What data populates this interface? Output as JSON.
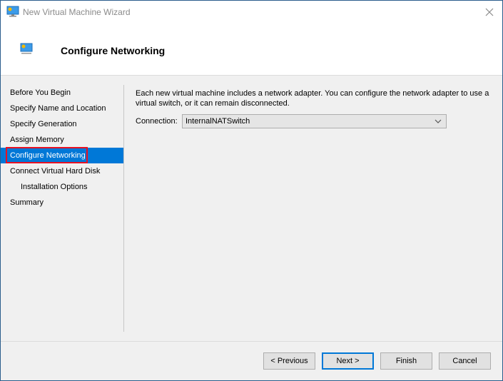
{
  "window": {
    "title": "New Virtual Machine Wizard",
    "close_label": "Close"
  },
  "header": {
    "title": "Configure Networking"
  },
  "sidebar": {
    "items": [
      {
        "label": "Before You Begin",
        "active": false,
        "sub": false
      },
      {
        "label": "Specify Name and Location",
        "active": false,
        "sub": false
      },
      {
        "label": "Specify Generation",
        "active": false,
        "sub": false
      },
      {
        "label": "Assign Memory",
        "active": false,
        "sub": false
      },
      {
        "label": "Configure Networking",
        "active": true,
        "sub": false
      },
      {
        "label": "Connect Virtual Hard Disk",
        "active": false,
        "sub": false
      },
      {
        "label": "Installation Options",
        "active": false,
        "sub": true
      },
      {
        "label": "Summary",
        "active": false,
        "sub": false
      }
    ]
  },
  "main": {
    "description": "Each new virtual machine includes a network adapter. You can configure the network adapter to use a virtual switch, or it can remain disconnected.",
    "connection_label": "Connection:",
    "connection_value": "InternalNATSwitch"
  },
  "buttons": {
    "previous": "< Previous",
    "next": "Next >",
    "finish": "Finish",
    "cancel": "Cancel"
  },
  "colors": {
    "accent": "#0078d7",
    "highlight_annotation": "#e81123"
  }
}
